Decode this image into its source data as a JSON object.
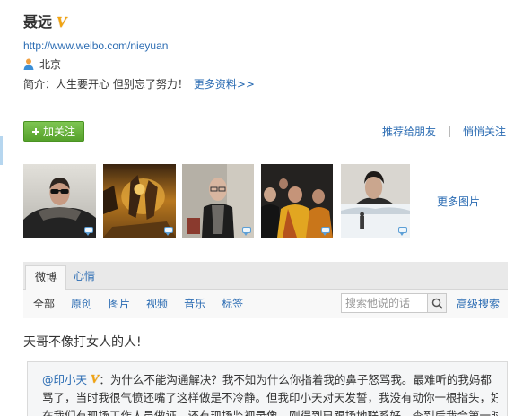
{
  "profile": {
    "name": "聂远",
    "verified_badge": "V",
    "url": "http://www.weibo.com/nieyuan",
    "location_icon": "user-icon",
    "location": "北京",
    "intro_label": "简介：",
    "intro_text": "人生要开心 但别忘了努力！",
    "more_info": "更多资料>>"
  },
  "actions": {
    "follow_icon": "plus-icon",
    "follow_label": "加关注",
    "recommend": "推荐给朋友",
    "quiet_follow": "悄悄关注"
  },
  "photos": {
    "badge_icon": "comment-icon",
    "more_photos": "更多图片"
  },
  "tabs": [
    {
      "label": "微博",
      "active": true
    },
    {
      "label": "心情",
      "active": false
    }
  ],
  "filters": {
    "items": [
      {
        "label": "全部",
        "active": true
      },
      {
        "label": "原创",
        "active": false
      },
      {
        "label": "图片",
        "active": false
      },
      {
        "label": "视频",
        "active": false
      },
      {
        "label": "音乐",
        "active": false
      },
      {
        "label": "标签",
        "active": false
      }
    ],
    "search_placeholder": "搜索他说的话",
    "search_icon": "search-icon",
    "advanced_search": "高级搜索"
  },
  "post": {
    "text": "天哥不像打女人的人!",
    "repost": {
      "author": "@印小天",
      "author_badge": "V",
      "lines": [
        "：为什么不能沟通解决？我不知为什么你指着我的鼻子怒骂我。最难听的我妈都",
        "骂了，当时我很气愤还嘴了这样做是不冷静。但我印小天对天发誓，我没有动你一根指头，好",
        "在我们有现场工作人员做证，还有现场监视录像，刚得到已跟场地联系好，查到后我会第一时"
      ]
    }
  },
  "colors": {
    "link": "#2b6cb3",
    "text": "#333333",
    "follow_button": "#55a12b",
    "verified_badge": "#f2a40e",
    "repost_background": "#f5f6f7"
  }
}
